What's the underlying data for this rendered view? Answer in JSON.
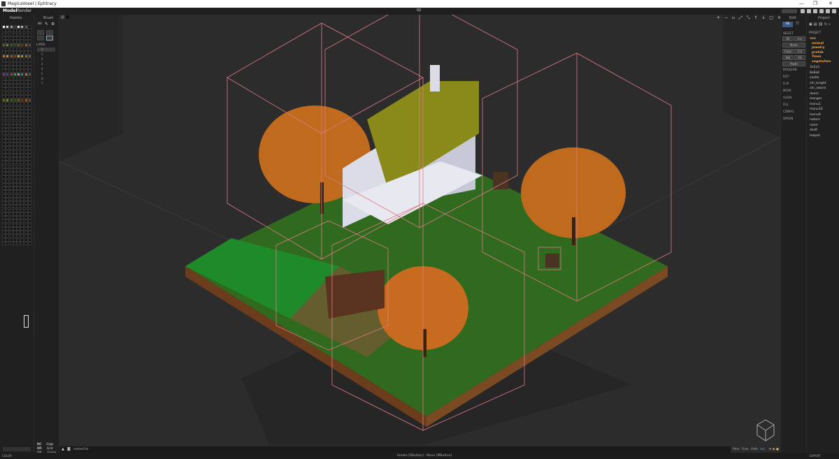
{
  "window": {
    "title": "MagicaVoxel | Ephtracy",
    "minimize": "—",
    "maximize": "❐",
    "close": "✕"
  },
  "menu": {
    "tabs": [
      "Model",
      "Render"
    ],
    "file_name": "02"
  },
  "left": {
    "palette_label": "Palette",
    "brush_label": "Brush",
    "brush_mode": "All",
    "layer_label": "LAYER",
    "layers": [
      "0",
      "1",
      "2",
      "3",
      "4",
      "5",
      "6",
      "7"
    ],
    "bottom_codes": [
      [
        "NO",
        "Edge"
      ],
      [
        "WR",
        "Grid"
      ],
      [
        "SW",
        "Frame"
      ]
    ],
    "color_label": "COLOR"
  },
  "right_edit": {
    "header": "Edit",
    "mode": "All",
    "select_label": "SELECT",
    "buttons": [
      [
        "All",
        "Inv"
      ],
      [
        "None",
        ""
      ],
      [
        "Copy",
        "Cut"
      ],
      [
        "Del",
        "Fill"
      ],
      [
        "Paste",
        ""
      ]
    ],
    "sections": [
      "BOOLEAN",
      "ROT",
      "FLIP",
      "MOVE",
      "ALIGN",
      "FILL",
      "CONFIG",
      "ORIGIN"
    ]
  },
  "right_project": {
    "header": "Project",
    "project_label": "PROJECT",
    "folders": [
      "vox",
      "animal",
      "jewelry",
      "prefab",
      "Trees",
      "vegetation"
    ],
    "items": [
      "3x3x3",
      "8x8x8",
      "castle",
      "chr_knight",
      "chr_sword",
      "doom",
      "menger",
      "monu1",
      "monu10",
      "monu9",
      "nature",
      "room",
      "shelf",
      "teapot"
    ],
    "export_label": "EXPORT"
  },
  "console": {
    "text": "console"
  },
  "viewport": {
    "cam_modes": [
      "Pers",
      "Free",
      "Orth",
      "Iso"
    ],
    "active_cam": "Iso"
  },
  "status": {
    "text": "Rotate [RButton] : Move [MButton]"
  },
  "colors": {
    "accent": "#4fa3ff",
    "bbox_line": "#e07a86",
    "grass": "#2f7a1f",
    "flat_grass": "#1e8a2a",
    "soil": "#7a4a22",
    "leaves": "#c86a1e",
    "roof": "#8a8a1a",
    "wall": "#dcdce8"
  }
}
